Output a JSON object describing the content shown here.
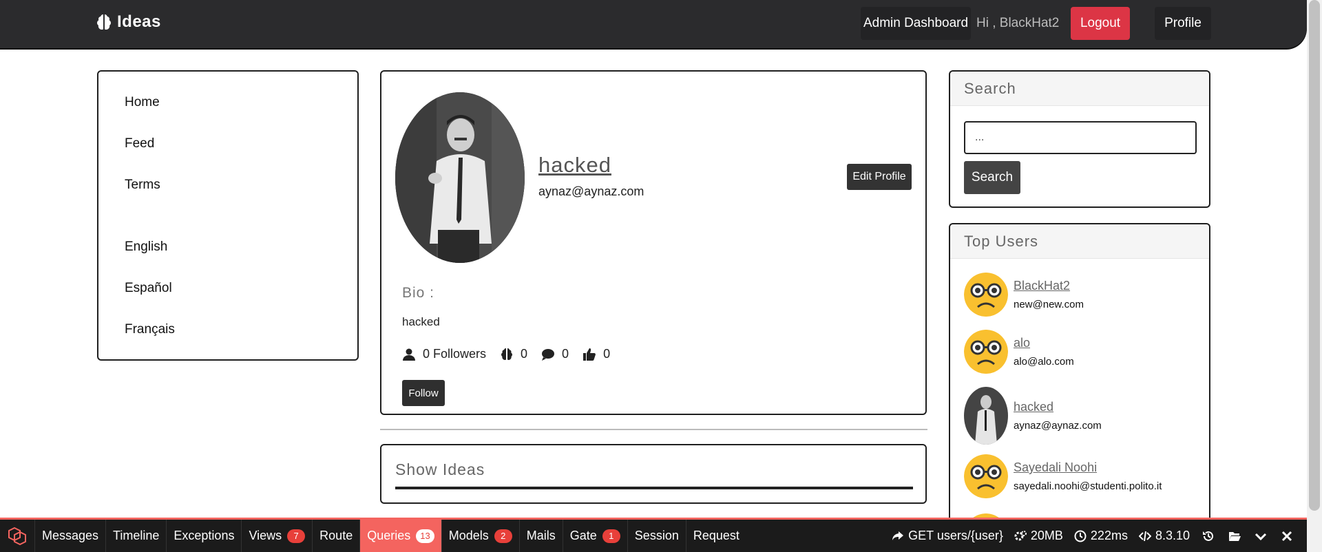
{
  "navbar": {
    "brand": "Ideas",
    "admin_dashboard": "Admin Dashboard",
    "greeting": "Hi , BlackHat2",
    "logout": "Logout",
    "profile": "Profile"
  },
  "menu": {
    "items": [
      "Home",
      "Feed",
      "Terms",
      "English",
      "Español",
      "Français"
    ]
  },
  "profile": {
    "name": "hacked",
    "email": "aynaz@aynaz.com",
    "edit_button": "Edit Profile",
    "bio_label": "Bio :",
    "bio_text": "hacked",
    "followers": "0 Followers",
    "ideas_count": "0",
    "comments_count": "0",
    "likes_count": "0",
    "follow_button": "Follow"
  },
  "ideas": {
    "title": "Show Ideas"
  },
  "search": {
    "title": "Search",
    "input_value": "...",
    "button": "Search"
  },
  "top_users": {
    "title": "Top Users",
    "users": [
      {
        "name": "BlackHat2",
        "email": "new@new.com",
        "avatar": "emoji-nerd-avatar"
      },
      {
        "name": "alo",
        "email": "alo@alo.com",
        "avatar": "emoji-nerd-avatar"
      },
      {
        "name": "hacked",
        "email": "aynaz@aynaz.com",
        "avatar": "photo-avatar"
      },
      {
        "name": "Sayedali Noohi",
        "email": "sayedali.noohi@studenti.polito.it",
        "avatar": "emoji-nerd-avatar"
      }
    ]
  },
  "debugbar": {
    "tabs": [
      {
        "label": "Messages",
        "badge": ""
      },
      {
        "label": "Timeline",
        "badge": ""
      },
      {
        "label": "Exceptions",
        "badge": ""
      },
      {
        "label": "Views",
        "badge": "7"
      },
      {
        "label": "Route",
        "badge": ""
      },
      {
        "label": "Queries",
        "badge": "13"
      },
      {
        "label": "Models",
        "badge": "2"
      },
      {
        "label": "Mails",
        "badge": ""
      },
      {
        "label": "Gate",
        "badge": "1"
      },
      {
        "label": "Session",
        "badge": ""
      },
      {
        "label": "Request",
        "badge": ""
      }
    ],
    "route": "GET users/{user}",
    "memory": "20MB",
    "time": "222ms",
    "php_version": "8.3.10"
  },
  "colors": {
    "navbar_bg": "#2b2b2d",
    "logout_red": "#dc3545",
    "debugbar_accent": "#f4645f",
    "emoji_yellow": "#f9c02f"
  }
}
